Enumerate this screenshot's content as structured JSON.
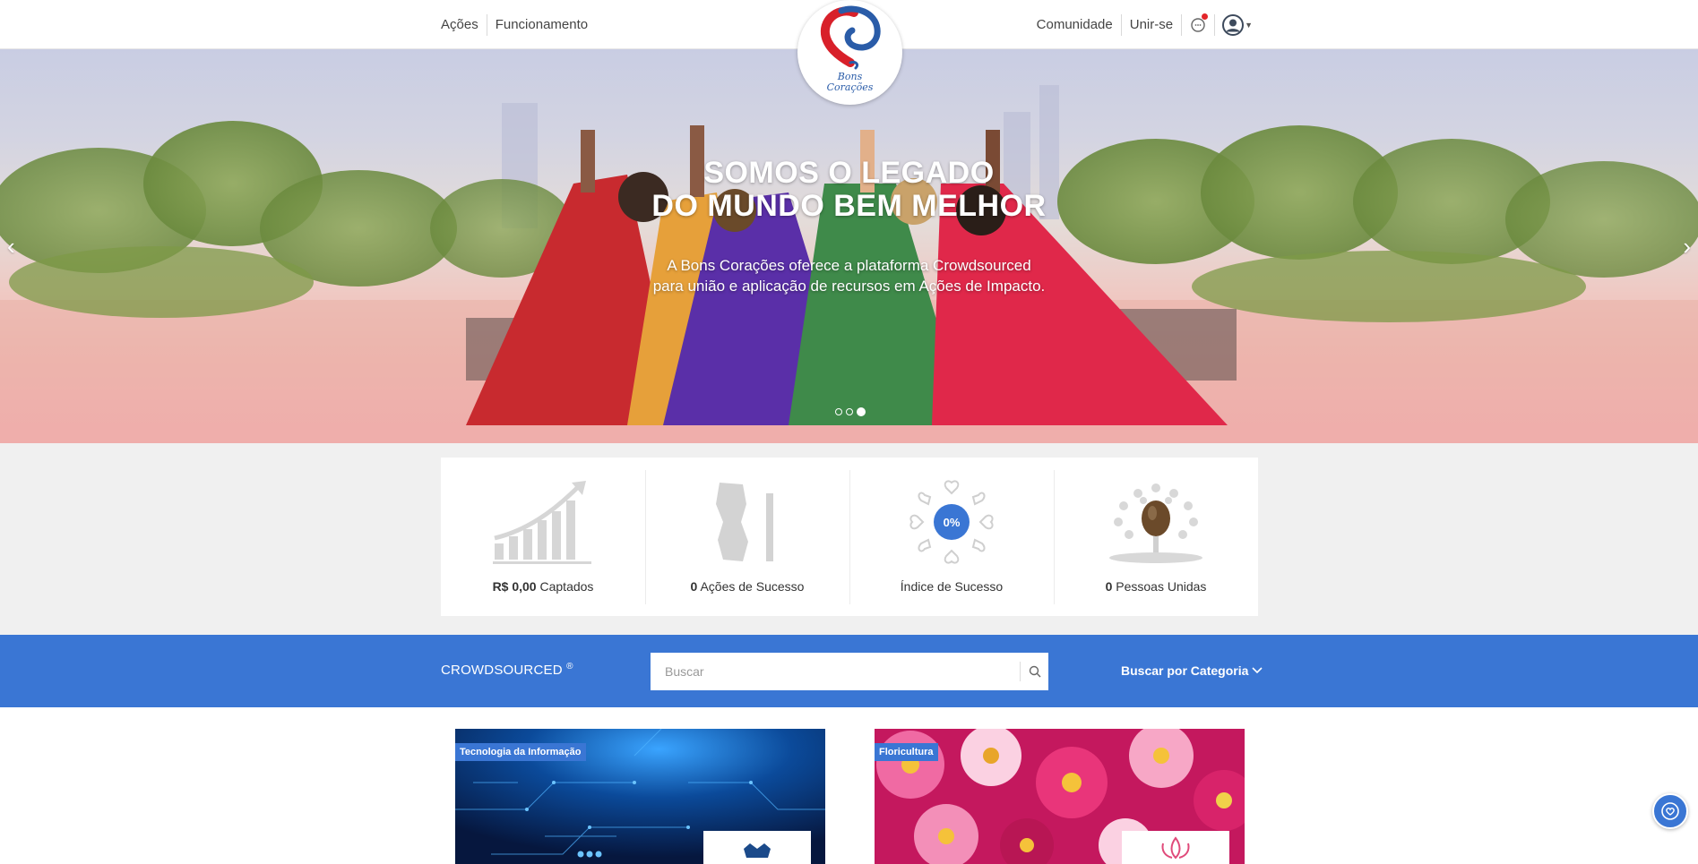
{
  "nav": {
    "left_links": [
      "Ações",
      "Funcionamento"
    ],
    "right_links": [
      "Comunidade",
      "Unir-se"
    ],
    "icons": {
      "chat": "chat-bubble-icon",
      "avatar": "user-avatar-icon",
      "caret": "chevron-down-icon"
    }
  },
  "logo": {
    "text_line1": "Bons",
    "text_line2": "Corações"
  },
  "hero": {
    "title_line1": "SOMOS O LEGADO",
    "title_line2": "DO MUNDO BEM MELHOR",
    "subtitle_line1": "A Bons Corações oferece a plataforma Crowdsourced",
    "subtitle_line2": "para união e aplicação de recursos em Ações de Impacto.",
    "slides_total": 3,
    "active_slide": 3
  },
  "stats": [
    {
      "value": "R$ 0,00",
      "label": "Captados",
      "icon": "growth-chart-icon"
    },
    {
      "value": "0",
      "label": "Ações de Sucesso",
      "icon": "trophy-icon"
    },
    {
      "value": "0%",
      "label": "Índice de Sucesso",
      "icon": "heart-wreath-icon",
      "badge": "0%"
    },
    {
      "value": "0",
      "label": "Pessoas Unidas",
      "icon": "tree-seed-icon"
    }
  ],
  "search": {
    "brand": "CROWDSOURCED",
    "brand_mark": "®",
    "placeholder": "Buscar",
    "category_label": "Buscar por Categoria"
  },
  "cards": [
    {
      "category": "Tecnologia da Informação"
    },
    {
      "category": "Floricultura"
    }
  ],
  "colors": {
    "accent": "#3a76d4",
    "notification": "#e3262a",
    "logo_red": "#d8202a",
    "logo_blue": "#2a5ca8"
  }
}
